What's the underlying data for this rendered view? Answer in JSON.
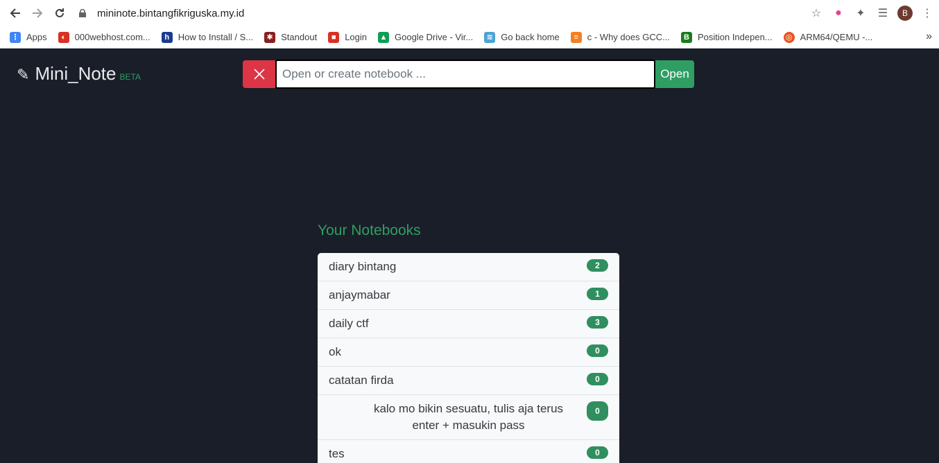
{
  "browser": {
    "url": "mininote.bintangfikriguska.my.id",
    "avatar_letter": "B",
    "bookmarks": [
      {
        "label": "Apps",
        "icon": "apps-grid-icon",
        "color": "#4285f4"
      },
      {
        "label": "000webhost.com...",
        "icon": "webhost-icon",
        "color": "#d93025"
      },
      {
        "label": "How to Install / S...",
        "icon": "h-icon",
        "color": "#1a3b8f"
      },
      {
        "label": "Standout",
        "icon": "standout-icon",
        "color": "#8a1f1f"
      },
      {
        "label": "Login",
        "icon": "login-icon",
        "color": "#d93025"
      },
      {
        "label": "Google Drive - Vir...",
        "icon": "drive-icon",
        "color": "#0f9d58"
      },
      {
        "label": "Go back home",
        "icon": "layers-icon",
        "color": "#4fa3d1"
      },
      {
        "label": "c - Why does GCC...",
        "icon": "stackoverflow-icon",
        "color": "#f48024"
      },
      {
        "label": "Position Indepen...",
        "icon": "b-icon",
        "color": "#1b7d1b"
      },
      {
        "label": "ARM64/QEMU -...",
        "icon": "ubuntu-icon",
        "color": "#e95420"
      }
    ]
  },
  "app": {
    "brand": "Mini_Note",
    "beta": "BETA",
    "search_placeholder": "Open or create notebook ...",
    "open_label": "Open",
    "notebooks_title": "Your Notebooks",
    "notebooks": [
      {
        "name": "diary bintang",
        "count": "2"
      },
      {
        "name": "anjaymabar",
        "count": "1"
      },
      {
        "name": "daily ctf",
        "count": "3"
      },
      {
        "name": "ok",
        "count": "0"
      },
      {
        "name": "catatan firda",
        "count": "0"
      },
      {
        "name": "kalo mo bikin sesuatu, tulis aja terus enter + masukin pass",
        "count": "0"
      },
      {
        "name": "tes",
        "count": "0"
      }
    ]
  }
}
